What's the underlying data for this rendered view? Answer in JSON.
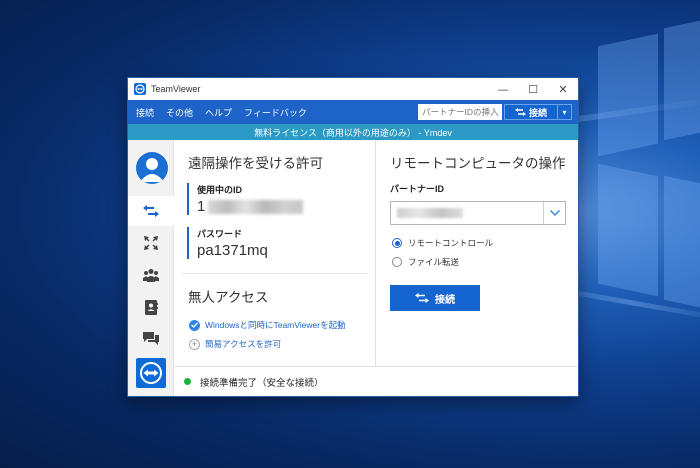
{
  "window": {
    "title": "TeamViewer"
  },
  "menu": {
    "items": [
      "接続",
      "その他",
      "ヘルプ",
      "フィードバック"
    ]
  },
  "toolbar": {
    "partner_placeholder": "パートナーIDの挿入",
    "connect_label": "接続"
  },
  "license": {
    "text": "無料ライセンス（商用以外の用途のみ） - Ymdev"
  },
  "remote_control": {
    "title": "遠隔操作を受ける許可",
    "id_label": "使用中のID",
    "id_value_prefix": "1",
    "password_label": "パスワード",
    "password_value": "pa1371mq"
  },
  "unattended": {
    "title": "無人アクセス",
    "option1": "Windowsと同時にTeamViewerを起動",
    "option2": "簡易アクセスを許可"
  },
  "remote_computer": {
    "title": "リモートコンピュータの操作",
    "partner_id_label": "パートナーID",
    "radio1": "リモートコントロール",
    "radio2": "ファイル転送",
    "radio1_selected": true,
    "connect_label": "接続"
  },
  "status": {
    "text": "接続準備完了（安全な接続）",
    "color": "#1fb23b"
  },
  "colors": {
    "accent": "#1e64c8",
    "license_bar": "#2b9ac4"
  }
}
